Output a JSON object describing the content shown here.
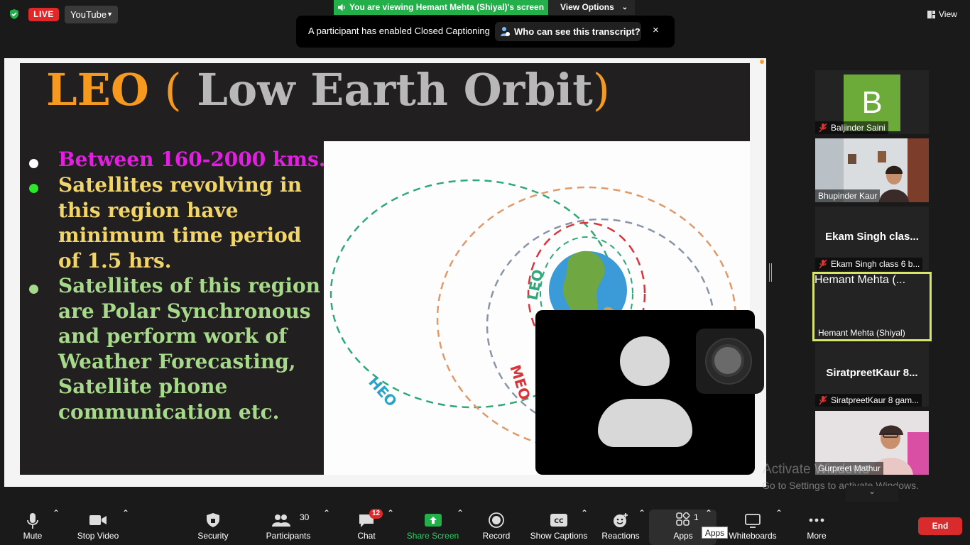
{
  "top_bar": {
    "live_label": "LIVE",
    "stream_target": "YouTube",
    "viewing_banner": "You are viewing Hemant Mehta (Shiyal)'s screen",
    "view_options_label": "View Options",
    "view_label": "View"
  },
  "caption_notice": {
    "message": "A participant has enabled Closed Captioning",
    "who_can_see_label": "Who can see this transcript?",
    "close_glyph": "×"
  },
  "slide": {
    "title_acronym": "LEO",
    "title_open": "(",
    "title_text": "Low Earth Orbit",
    "title_close": ")",
    "bullets": [
      {
        "text": "Between 160-2000 kms.",
        "color": "#e21ee0",
        "dot_color": "#ffffff"
      },
      {
        "text": "Satellites revolving in\nthis region have\nminimum time period\nof 1.5 hrs.",
        "color": "#f1d569",
        "dot_color": "#2ee62e"
      },
      {
        "text": "Satellites of this region\nare Polar Synchronous\nand perform work of\nWeather Forecasting,\nSatellite phone\ncommunication etc.",
        "color": "#a7d98a",
        "dot_color": "#a7d98a"
      }
    ],
    "diagram_labels": {
      "leo": "LEO",
      "meo": "MEO",
      "heo": "HEO"
    }
  },
  "participants": [
    {
      "name": "Baljinder Saini",
      "avatar_letter": "B",
      "muted": true,
      "video": false
    },
    {
      "name": "Bhupinder Kaur",
      "muted": false,
      "video": true
    },
    {
      "name": "Ekam Singh class 6 b...",
      "display_name": "Ekam Singh clas...",
      "muted": true,
      "video": false
    },
    {
      "name": "Hemant Mehta (Shiyal)",
      "display_name": "Hemant Mehta (...",
      "muted": false,
      "video": false,
      "active_speaker": true
    },
    {
      "name": "SiratpreetKaur 8 gam...",
      "display_name": "SiratpreetKaur 8...",
      "muted": true,
      "video": false
    },
    {
      "name": "Gurpreet Mathur",
      "muted": false,
      "video": true
    }
  ],
  "watermark": {
    "line1": "Activate Windows",
    "line2": "Go to Settings to activate Windows."
  },
  "toolbar": {
    "mute": "Mute",
    "stop_video": "Stop Video",
    "security": "Security",
    "participants": "Participants",
    "participants_count": "30",
    "chat": "Chat",
    "chat_badge": "12",
    "share_screen": "Share Screen",
    "record": "Record",
    "show_captions": "Show Captions",
    "reactions": "Reactions",
    "apps": "Apps",
    "apps_count": "1",
    "apps_tooltip": "Apps",
    "whiteboards": "Whiteboards",
    "more": "More",
    "end": "End"
  },
  "colors": {
    "share_green": "#23b04a",
    "live_red": "#e02828",
    "end_red": "#d92b2b",
    "speaker_highlight": "#d8e56a",
    "title_orange": "#f59a1e"
  }
}
